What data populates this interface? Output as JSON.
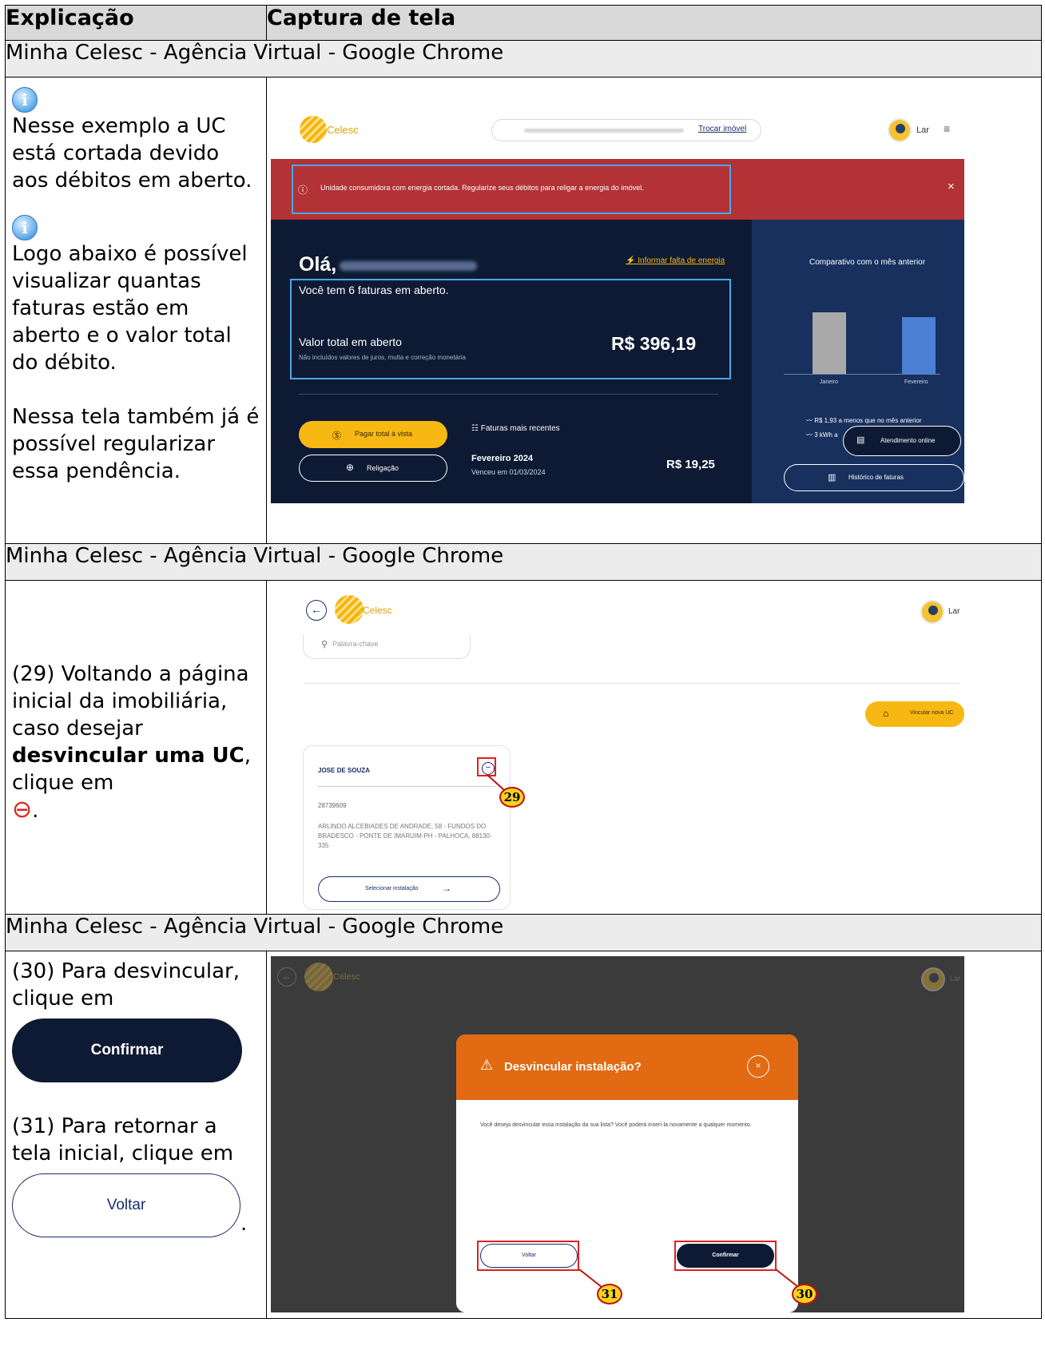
{
  "table": {
    "col1": "Explicação",
    "col2": "Captura de tela"
  },
  "sections": [
    {
      "window_title": "Minha Celesc - Agência Virtual - Google Chrome",
      "left_p1": "Nesse exemplo a UC está cortada devido aos débitos em aberto.",
      "left_p2": "Logo abaixo é possível visualizar quantas faturas estão em aberto e o valor total do débito.",
      "left_p3": "Nessa tela também já é possível regularizar essa pendência.",
      "shot": {
        "logo_text": "Celesc",
        "trocar": "Trocar imóvel",
        "user": "Lar",
        "alert": "Unidade consumidora com energia cortada. Regularize seus débitos para religar a energia do imóvel.",
        "close": "×",
        "greeting": "Olá,",
        "report": "Informar falta de energia",
        "faturas_text": "Você tem 6 faturas em aberto.",
        "valor_label": "Valor total em aberto",
        "valor_note": "Não incluídos valores de juros, multa e correção monetária",
        "valor": "R$ 396,19",
        "pagar": "Pagar total à vista",
        "religacao": "Religação",
        "recentes": "Faturas mais recentes",
        "fatura_mes": "Fevereiro 2024",
        "fatura_venc": "Venceu em 01/03/2024",
        "fatura_valor": "R$ 19,25",
        "comparativo": "Comparativo com o mês anterior",
        "bar1_label": "Janeiro",
        "bar2_label": "Fevereiro",
        "stat1": "R$ 1,93 a menos que no mês anterior",
        "stat2": "3 kWh a",
        "atendimento": "Atendimento online",
        "historico": "Histórico de faturas"
      }
    },
    {
      "window_title": "Minha Celesc - Agência Virtual - Google Chrome",
      "left_a": "(29) Voltando a página inicial da imobiliária, caso desejar ",
      "left_b": "desvincular uma UC",
      "left_c": ", clique em",
      "left_d": ".",
      "shot": {
        "logo_text": "Celesc",
        "user": "Lar",
        "search_placeholder": "Palavra-chave",
        "vincular": "Vincular nova UC",
        "card_name": "JOSE DE SOUZA",
        "card_number": "28739609",
        "card_address": "ARLINDO ALCEBIADES DE ANDRADE, 58 - FUNDOS DO BRADESCO - PONTE DE IMARUIM-PH - PALHOCA, 88130-335",
        "selecionar": "Selecionar instalação",
        "callout": "29"
      }
    },
    {
      "window_title": "Minha Celesc - Agência Virtual - Google Chrome",
      "left_a": "(30) Para desvincular, clique em",
      "confirm_btn": "Confirmar",
      "left_b": "(31) Para retornar a tela inicial, clique em",
      "voltar_btn": "Voltar",
      "left_c": ".",
      "shot": {
        "logo_text": "Celesc",
        "user": "Lar",
        "modal_title": "Desvincular instalação?",
        "modal_text": "Você deseja desvincular essa instalação da sua lista? Você poderá inserí-la novamente a qualquer momento.",
        "voltar": "Voltar",
        "confirmar": "Confirmar",
        "callout31": "31",
        "callout30": "30"
      }
    }
  ],
  "colors": {
    "brand_yellow": "#f7b813",
    "navy": "#0e1a33",
    "alert_red": "#b23236",
    "modal_orange": "#e16a12",
    "callout_red": "#e02020"
  }
}
